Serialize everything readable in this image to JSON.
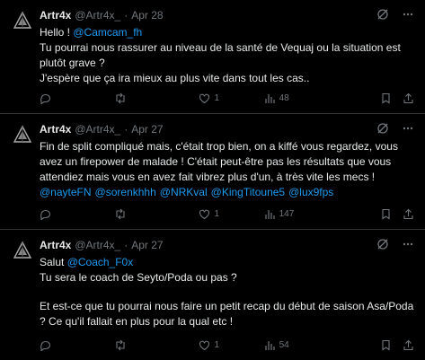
{
  "tweets": [
    {
      "name": "Artr4x",
      "handle": "@Artr4x_",
      "sep": "·",
      "date": "Apr 28",
      "line1_prefix": "Hello ! ",
      "line1_link": "@Camcam_fh",
      "line2": "Tu pourrai nous rassurer au niveau de la santé de Vequaj ou la situation est plutôt grave ?",
      "line3": "J'espère que ça ira mieux au plus vite dans tout les cas..",
      "likes": "1",
      "views": "48"
    },
    {
      "name": "Artr4x",
      "handle": "@Artr4x_",
      "sep": "·",
      "date": "Apr 27",
      "text": "Fin de split compliqué mais, c'était trop bien, on a kiffé vous regardez, vous avez un firepower de malade ! C'était peut-être pas les résultats que vous attendiez mais vous en avez fait vibrez plus d'un, à très vite les mecs !",
      "mentions": [
        "@nayteFN",
        "@sorenkhhh",
        "@NRKval",
        "@KingTitoune5",
        "@lux9fps"
      ],
      "likes": "1",
      "views": "147"
    },
    {
      "name": "Artr4x",
      "handle": "@Artr4x_",
      "sep": "·",
      "date": "Apr 27",
      "line1_prefix": "Salut ",
      "line1_link": "@Coach_F0x",
      "line2": "Tu sera le coach de Seyto/Poda ou pas ?",
      "line3": "Et est-ce que tu pourrai nous faire un petit recap du début de saison Asa/Poda ? Ce qu'il fallait en plus pour la qual etc !",
      "likes": "1",
      "views": "54"
    }
  ],
  "icons": {
    "avatar": "wolf-logo-icon",
    "grok": "grok-icon",
    "more": "more-icon",
    "reply": "reply-icon",
    "retweet": "retweet-icon",
    "like": "heart-icon",
    "views": "views-icon",
    "bookmark": "bookmark-icon",
    "share": "share-icon"
  },
  "colors": {
    "background": "#000000",
    "text": "#e7e9ea",
    "muted": "#71767b",
    "link": "#1d9bf0",
    "border": "#2f3336"
  }
}
